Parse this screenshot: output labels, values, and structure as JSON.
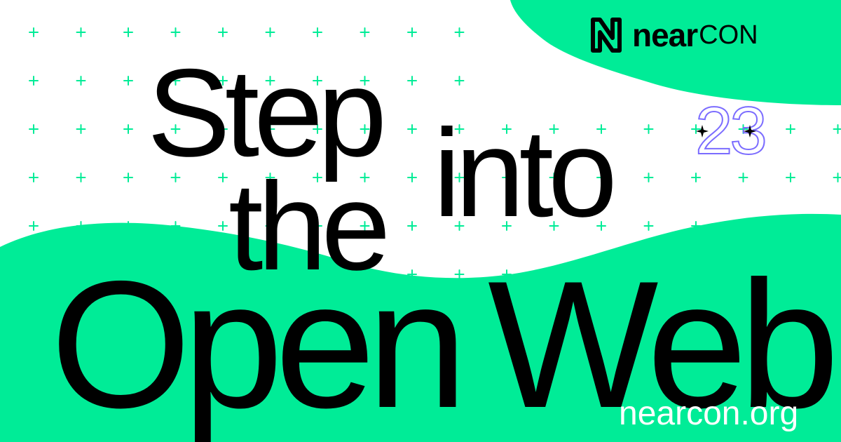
{
  "brand": {
    "wordmark": "near",
    "wordmark_suffix": "CON",
    "logo_icon": "near-n-logo-icon",
    "year": "23",
    "accent_color": "#00ec97",
    "year_outline_color": "#7b6cff"
  },
  "headline": {
    "line1": "Step",
    "line2": "into",
    "line3": "the",
    "line4_word1": "Open",
    "line4_word2": "Web"
  },
  "url": "nearcon.org",
  "decor": {
    "pattern_icon": "plus-icon",
    "sparkle_icon": "sparkle-icon"
  }
}
